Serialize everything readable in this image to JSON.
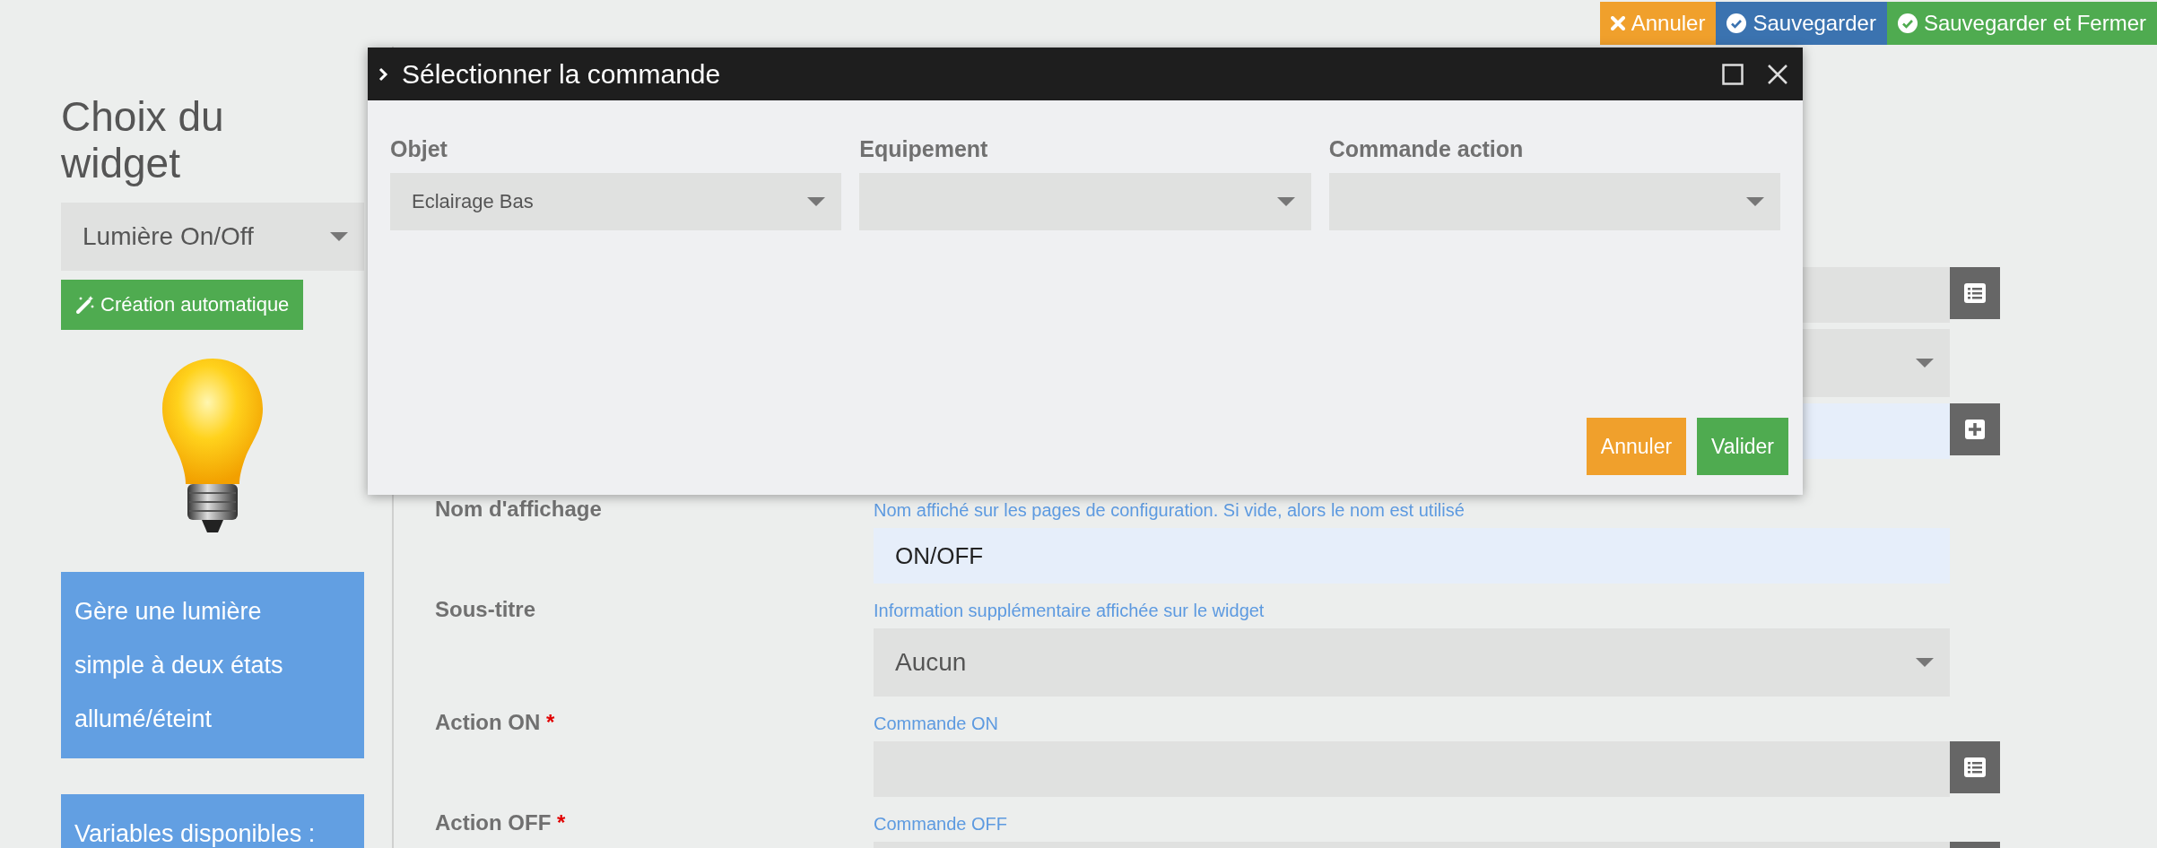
{
  "header_buttons": [
    {
      "kind": "cancel",
      "label": "Annuler"
    },
    {
      "kind": "save",
      "label": "Sauvegarder"
    },
    {
      "kind": "save-close",
      "label": "Sauvegarder et Fermer"
    }
  ],
  "sidebar": {
    "title": "Choix du widget",
    "widget_select": "Lumière On/Off",
    "auto_button": "Création automatique",
    "description": "Gère une lumière simple à deux états allumé/éteint",
    "variables_title": "Variables disponibles :"
  },
  "form": {
    "rows": [
      {
        "kind": "command"
      },
      {
        "kind": "select"
      },
      {
        "kind": "text-add"
      },
      {
        "kind": "text",
        "label": "Nom d'affichage",
        "hint": "Nom affiché sur les pages de configuration. Si vide, alors le nom est utilisé",
        "value": "ON/OFF"
      },
      {
        "kind": "select",
        "label": "Sous-titre",
        "hint": "Information supplémentaire affichée sur le widget",
        "value": "Aucun"
      },
      {
        "kind": "command",
        "label": "Action ON",
        "required_mark": "*",
        "hint": "Commande ON"
      },
      {
        "kind": "command",
        "label": "Action OFF",
        "required_mark": "*",
        "hint": "Commande OFF"
      }
    ]
  },
  "dialog": {
    "title": "Sélectionner la commande",
    "columns": [
      {
        "label": "Objet",
        "value": "Eclairage Bas"
      },
      {
        "label": "Equipement"
      },
      {
        "label": "Commande action"
      }
    ],
    "buttons": [
      {
        "kind": "cancel",
        "label": "Annuler"
      },
      {
        "kind": "confirm",
        "label": "Valider"
      }
    ]
  }
}
